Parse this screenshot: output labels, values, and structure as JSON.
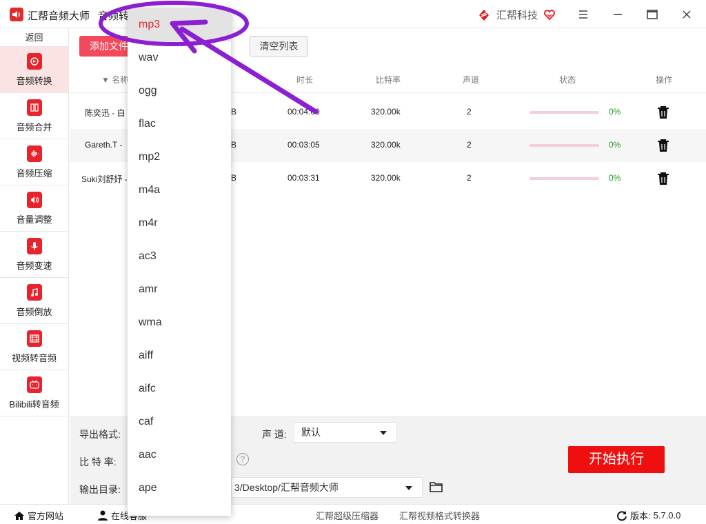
{
  "app": {
    "title": "汇帮音频大师",
    "page_title": "音频转换",
    "brand": "汇帮科技"
  },
  "sidebar": {
    "back": "返回",
    "items": [
      {
        "label": "音频转换",
        "icon": "audio-convert-icon"
      },
      {
        "label": "音频合并",
        "icon": "audio-merge-icon"
      },
      {
        "label": "音频压缩",
        "icon": "audio-compress-icon"
      },
      {
        "label": "音量调整",
        "icon": "volume-icon"
      },
      {
        "label": "音频变速",
        "icon": "microphone-icon"
      },
      {
        "label": "音频倒放",
        "icon": "music-note-icon"
      },
      {
        "label": "视频转音频",
        "icon": "film-icon"
      },
      {
        "label": "Bilibili转音频",
        "icon": "bilibili-icon"
      }
    ]
  },
  "toolbar": {
    "add_file": "添加文件",
    "clear_list": "清空列表"
  },
  "table": {
    "columns": {
      "name": "名称",
      "duration": "时长",
      "bitrate": "比特率",
      "channels": "声道",
      "status": "状态",
      "action": "操作"
    },
    "rows": [
      {
        "name": "陈奕迅 - 白",
        "size": "B",
        "duration": "00:04:00",
        "bitrate": "320.00k",
        "channels": "2",
        "progress": "0%"
      },
      {
        "name": "Gareth.T -",
        "size": "B",
        "duration": "00:03:05",
        "bitrate": "320.00k",
        "channels": "2",
        "progress": "0%"
      },
      {
        "name": "Suki刘舒妤 -",
        "size": "B",
        "duration": "00:03:31",
        "bitrate": "320.00k",
        "channels": "2",
        "progress": "0%"
      }
    ]
  },
  "settings": {
    "format_label": "导出格式:",
    "channel_label": "声 道:",
    "channel_value": "默认",
    "bitrate_label": "比 特 率:",
    "help": "?",
    "output_label": "输出目录:",
    "output_value": "3/Desktop/汇帮音频大师",
    "start": "开始执行"
  },
  "statusbar": {
    "website": "官方网站",
    "online_service": "在线客服",
    "link1": "汇帮超级压缩器",
    "link2": "汇帮视频格式转换器",
    "version_label": "版本:",
    "version": "5.7.0.0"
  },
  "format_dropdown": {
    "selected": "mp3",
    "options": [
      "mp3",
      "wav",
      "ogg",
      "flac",
      "mp2",
      "m4a",
      "m4r",
      "ac3",
      "amr",
      "wma",
      "aiff",
      "aifc",
      "caf",
      "aac",
      "ape"
    ]
  },
  "colors": {
    "accent": "#e8232c",
    "annotation": "#8b1fd1",
    "success": "#1a9a1a"
  }
}
